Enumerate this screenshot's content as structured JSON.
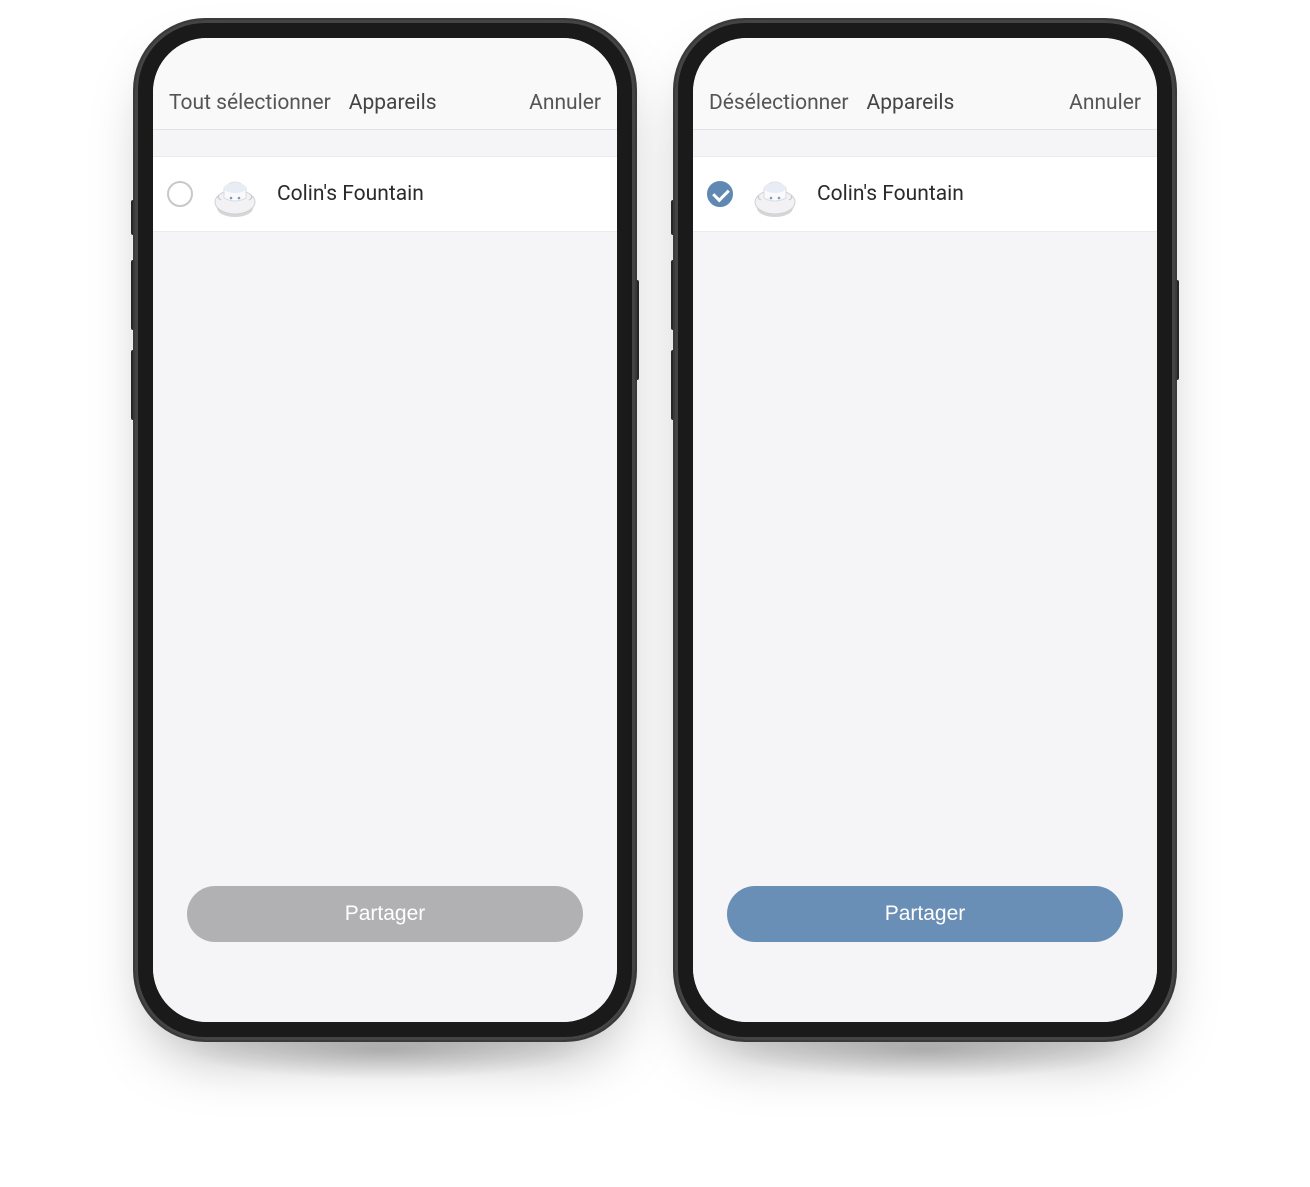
{
  "phones": [
    {
      "header": {
        "select_action": "Tout sélectionner",
        "title": "Appareils",
        "cancel": "Annuler"
      },
      "device": {
        "name": "Colin's Fountain",
        "checked": false,
        "icon": "fountain-icon"
      },
      "share_button": {
        "label": "Partager",
        "state": "disabled"
      }
    },
    {
      "header": {
        "select_action": "Désélectionner",
        "title": "Appareils",
        "cancel": "Annuler"
      },
      "device": {
        "name": "Colin's Fountain",
        "checked": true,
        "icon": "fountain-icon"
      },
      "share_button": {
        "label": "Partager",
        "state": "enabled"
      }
    }
  ],
  "colors": {
    "accent": "#6a8fb6",
    "disabled": "#b1b1b4",
    "checkbox_checked": "#5f89b2"
  }
}
